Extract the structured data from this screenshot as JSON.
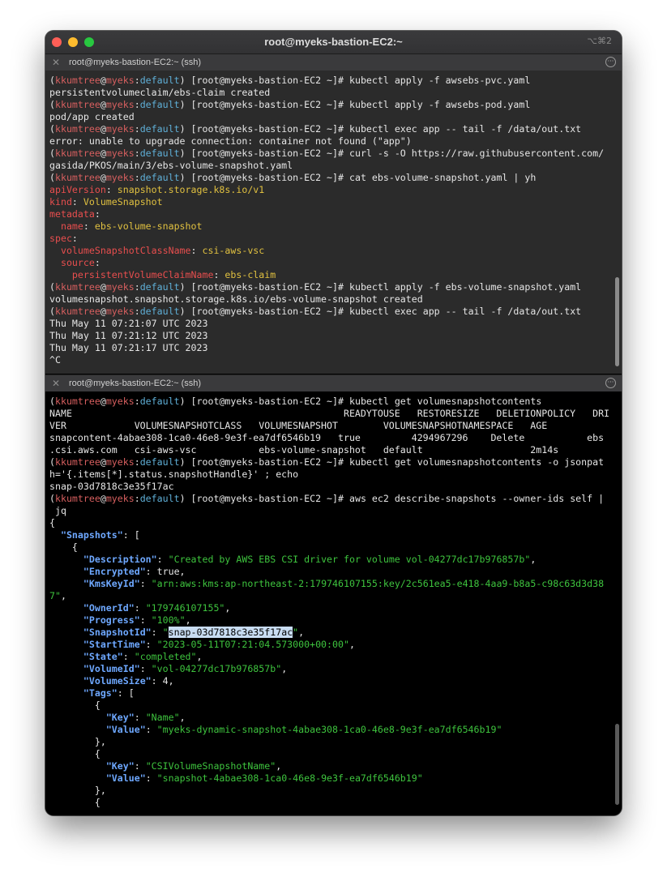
{
  "window": {
    "title": "root@myeks-bastion-EC2:~",
    "shortcut": "⌥⌘2"
  },
  "panes": {
    "top": {
      "header_close": "✕",
      "header_title": "root@myeks-bastion-EC2:~ (ssh)",
      "header_more": "···"
    },
    "bottom": {
      "header_close": "✕",
      "header_title": "root@myeks-bastion-EC2:~ (ssh)",
      "header_more": "···"
    }
  },
  "prompt": {
    "open": "(",
    "user": "kkumtree",
    "at": "@",
    "host": "myeks",
    "colon": ":",
    "ns": "default",
    "rest": ") [root@myeks-bastion-EC2 ~]# "
  },
  "top_lines": [
    {
      "type": "prompt",
      "cmd": "kubectl apply -f awsebs-pvc.yaml"
    },
    {
      "type": "out",
      "text": "persistentvolumeclaim/ebs-claim created"
    },
    {
      "type": "prompt",
      "cmd": "kubectl apply -f awsebs-pod.yaml"
    },
    {
      "type": "out",
      "text": "pod/app created"
    },
    {
      "type": "prompt",
      "cmd": "kubectl exec app -- tail -f /data/out.txt"
    },
    {
      "type": "out",
      "text": "error: unable to upgrade connection: container not found (\"app\")"
    },
    {
      "type": "prompt",
      "cmd": "curl -s -O https://raw.githubusercontent.com/"
    },
    {
      "type": "out",
      "text": "gasida/PKOS/main/3/ebs-volume-snapshot.yaml"
    },
    {
      "type": "prompt",
      "cmd": "cat ebs-volume-snapshot.yaml | yh"
    },
    {
      "type": "yaml",
      "indent": "",
      "key": "apiVersion",
      "sep": ": ",
      "val": "snapshot.storage.k8s.io/v1"
    },
    {
      "type": "yaml",
      "indent": "",
      "key": "kind",
      "sep": ": ",
      "val": "VolumeSnapshot"
    },
    {
      "type": "yaml",
      "indent": "",
      "key": "metadata",
      "sep": ":",
      "val": ""
    },
    {
      "type": "yaml",
      "indent": "  ",
      "key": "name",
      "sep": ": ",
      "val": "ebs-volume-snapshot"
    },
    {
      "type": "yaml",
      "indent": "",
      "key": "spec",
      "sep": ":",
      "val": ""
    },
    {
      "type": "yaml",
      "indent": "  ",
      "key": "volumeSnapshotClassName",
      "sep": ": ",
      "val": "csi-aws-vsc"
    },
    {
      "type": "yaml",
      "indent": "  ",
      "key": "source",
      "sep": ":",
      "val": ""
    },
    {
      "type": "yaml",
      "indent": "    ",
      "key": "persistentVolumeClaimName",
      "sep": ": ",
      "val": "ebs-claim"
    },
    {
      "type": "prompt",
      "cmd": "kubectl apply -f ebs-volume-snapshot.yaml"
    },
    {
      "type": "out",
      "text": "volumesnapshot.snapshot.storage.k8s.io/ebs-volume-snapshot created"
    },
    {
      "type": "prompt",
      "cmd": "kubectl exec app -- tail -f /data/out.txt"
    },
    {
      "type": "out",
      "text": "Thu May 11 07:21:07 UTC 2023"
    },
    {
      "type": "out",
      "text": "Thu May 11 07:21:12 UTC 2023"
    },
    {
      "type": "out",
      "text": "Thu May 11 07:21:17 UTC 2023"
    },
    {
      "type": "out",
      "text": "^C"
    }
  ],
  "bottom_lines": [
    {
      "type": "prompt",
      "cmd": "kubectl get volumesnapshotcontents"
    },
    {
      "type": "out",
      "text": "NAME                                                READYTOUSE   RESTORESIZE   DELETIONPOLICY   DRI"
    },
    {
      "type": "out",
      "text": "VER            VOLUMESNAPSHOTCLASS   VOLUMESNAPSHOT        VOLUMESNAPSHOTNAMESPACE   AGE"
    },
    {
      "type": "out",
      "text": "snapcontent-4abae308-1ca0-46e8-9e3f-ea7df6546b19   true         4294967296    Delete           ebs"
    },
    {
      "type": "out",
      "text": ".csi.aws.com   csi-aws-vsc           ebs-volume-snapshot   default                   2m14s"
    },
    {
      "type": "prompt",
      "cmd": "kubectl get volumesnapshotcontents -o jsonpat"
    },
    {
      "type": "out",
      "text": "h='{.items[*].status.snapshotHandle}' ; echo"
    },
    {
      "type": "out",
      "text": "snap-03d7818c3e35f17ac"
    },
    {
      "type": "prompt",
      "cmd": "aws ec2 describe-snapshots --owner-ids self |"
    },
    {
      "type": "out",
      "text": " jq"
    },
    {
      "type": "out",
      "text": "{"
    },
    {
      "type": "json",
      "indent": "  ",
      "key": "\"Snapshots\"",
      "sep": ": ",
      "val": "",
      "tail": "["
    },
    {
      "type": "out",
      "text": "    {"
    },
    {
      "type": "json",
      "indent": "      ",
      "key": "\"Description\"",
      "sep": ": ",
      "val": "\"Created by AWS EBS CSI driver for volume vol-04277dc17b976857b\"",
      "tail": ","
    },
    {
      "type": "json",
      "indent": "      ",
      "key": "\"Encrypted\"",
      "sep": ": ",
      "val": "",
      "tail": "true,"
    },
    {
      "type": "json",
      "indent": "      ",
      "key": "\"KmsKeyId\"",
      "sep": ": ",
      "val": "\"arn:aws:kms:ap-northeast-2:179746107155:key/2c561ea5-e418-4aa9-b8a5-c98c63d3d38",
      "tail": ""
    },
    {
      "type": "json",
      "indent": "",
      "key": "",
      "sep": "",
      "val": "7\"",
      "tail": ","
    },
    {
      "type": "json",
      "indent": "      ",
      "key": "\"OwnerId\"",
      "sep": ": ",
      "val": "\"179746107155\"",
      "tail": ","
    },
    {
      "type": "json",
      "indent": "      ",
      "key": "\"Progress\"",
      "sep": ": ",
      "val": "\"100%\"",
      "tail": ","
    },
    {
      "type": "snapid",
      "indent": "      ",
      "key": "\"SnapshotId\"",
      "sep": ": ",
      "q1": "\"",
      "val": "snap-03d7818c3e35f17ac",
      "q2": "\"",
      "tail": ","
    },
    {
      "type": "json",
      "indent": "      ",
      "key": "\"StartTime\"",
      "sep": ": ",
      "val": "\"2023-05-11T07:21:04.573000+00:00\"",
      "tail": ","
    },
    {
      "type": "json",
      "indent": "      ",
      "key": "\"State\"",
      "sep": ": ",
      "val": "\"completed\"",
      "tail": ","
    },
    {
      "type": "json",
      "indent": "      ",
      "key": "\"VolumeId\"",
      "sep": ": ",
      "val": "\"vol-04277dc17b976857b\"",
      "tail": ","
    },
    {
      "type": "json",
      "indent": "      ",
      "key": "\"VolumeSize\"",
      "sep": ": ",
      "val": "",
      "tail": "4,"
    },
    {
      "type": "json",
      "indent": "      ",
      "key": "\"Tags\"",
      "sep": ": ",
      "val": "",
      "tail": "["
    },
    {
      "type": "out",
      "text": "        {"
    },
    {
      "type": "json",
      "indent": "          ",
      "key": "\"Key\"",
      "sep": ": ",
      "val": "\"Name\"",
      "tail": ","
    },
    {
      "type": "json",
      "indent": "          ",
      "key": "\"Value\"",
      "sep": ": ",
      "val": "\"myeks-dynamic-snapshot-4abae308-1ca0-46e8-9e3f-ea7df6546b19\"",
      "tail": ""
    },
    {
      "type": "out",
      "text": "        },"
    },
    {
      "type": "out",
      "text": "        {"
    },
    {
      "type": "json",
      "indent": "          ",
      "key": "\"Key\"",
      "sep": ": ",
      "val": "\"CSIVolumeSnapshotName\"",
      "tail": ","
    },
    {
      "type": "json",
      "indent": "          ",
      "key": "\"Value\"",
      "sep": ": ",
      "val": "\"snapshot-4abae308-1ca0-46e8-9e3f-ea7df6546b19\"",
      "tail": ""
    },
    {
      "type": "out",
      "text": "        },"
    },
    {
      "type": "out",
      "text": "        {"
    }
  ],
  "colors": {
    "user": "#d75f5f",
    "namespace": "#5fafd7",
    "yaml_key": "#e84e4e",
    "yaml_value": "#e0c040",
    "json_key": "#6ea8ff",
    "json_string": "#3ec43e",
    "selection": "#c8dcf2"
  }
}
